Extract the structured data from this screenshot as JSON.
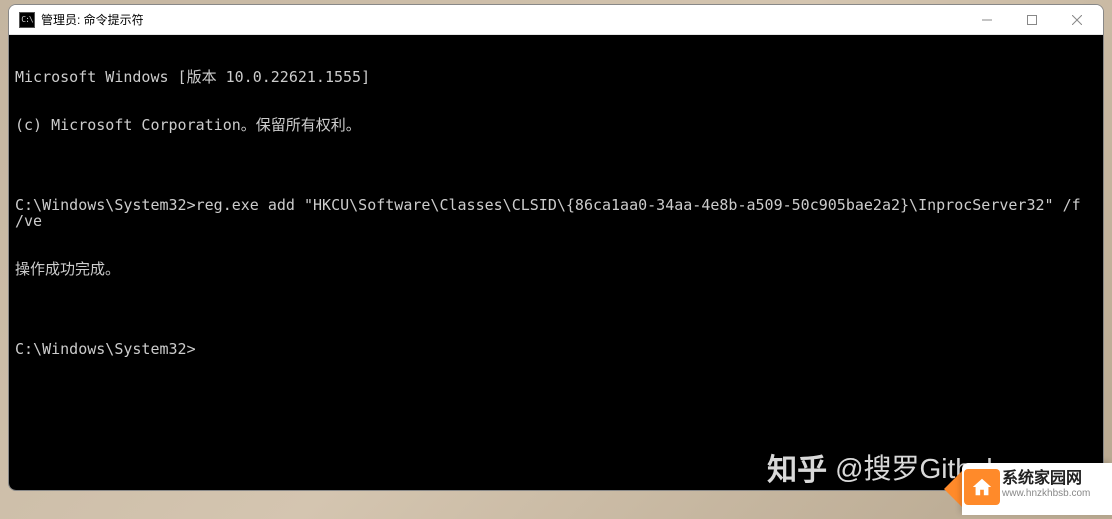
{
  "window": {
    "title": "管理员: 命令提示符"
  },
  "terminal": {
    "lines": [
      "Microsoft Windows [版本 10.0.22621.1555]",
      "(c) Microsoft Corporation。保留所有权利。",
      "",
      "C:\\Windows\\System32>reg.exe add \"HKCU\\Software\\Classes\\CLSID\\{86ca1aa0-34aa-4e8b-a509-50c905bae2a2}\\InprocServer32\" /f /ve",
      "操作成功完成。",
      "",
      "C:\\Windows\\System32>"
    ]
  },
  "watermarks": {
    "zhihu_logo": "知乎",
    "zhihu_text": "@搜罗Github",
    "badge_title": "系统家园网",
    "badge_sub": "www.hnzkhbsb.com"
  }
}
